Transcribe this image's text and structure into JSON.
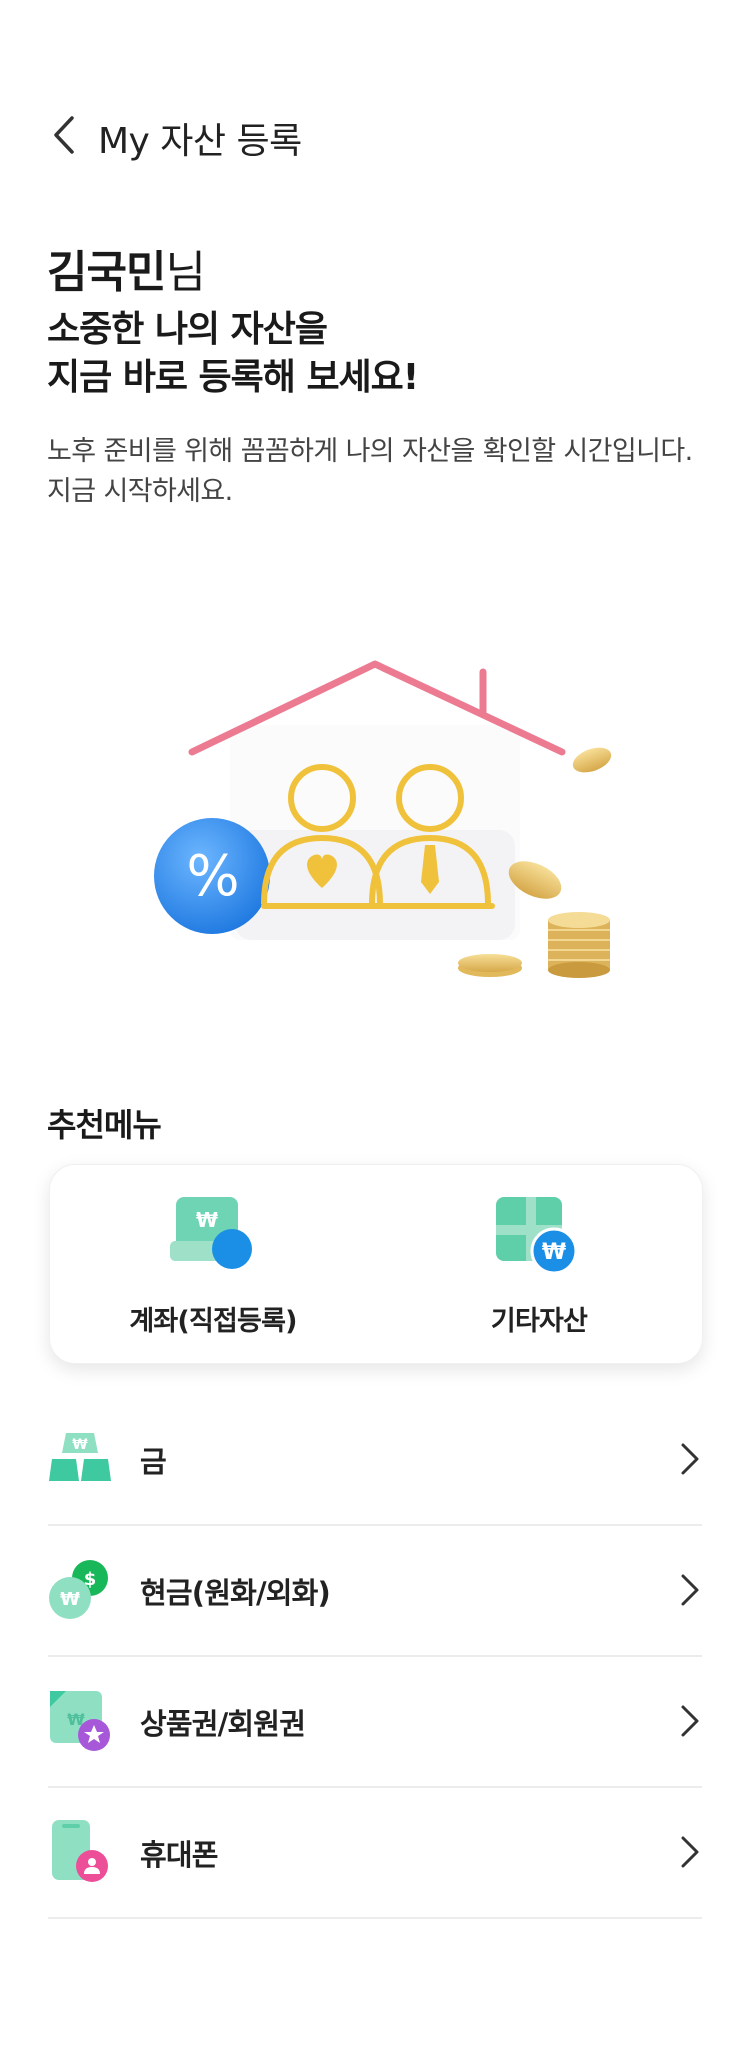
{
  "header": {
    "title": "My 자산 등록"
  },
  "greeting": {
    "name": "김국민",
    "suffix": "님"
  },
  "headline": {
    "line1": "소중한 나의 자산을",
    "line2": "지금 바로 등록해 보세요!"
  },
  "description": {
    "line1": "노후 준비를 위해 꼼꼼하게 나의 자산을 확인할 시간입니다.",
    "line2": "지금 시작하세요."
  },
  "hero": {
    "percent_symbol": "%"
  },
  "recommended": {
    "title": "추천메뉴",
    "items": [
      {
        "label": "계좌(직접등록)",
        "icon": "account-card-icon"
      },
      {
        "label": "기타자산",
        "icon": "other-assets-icon"
      }
    ]
  },
  "list": {
    "items": [
      {
        "label": "금",
        "icon": "gold-bars-icon"
      },
      {
        "label": "현금(원화/외화)",
        "icon": "cash-coins-icon"
      },
      {
        "label": "상품권/회원권",
        "icon": "voucher-icon"
      },
      {
        "label": "휴대폰",
        "icon": "phone-icon"
      }
    ]
  },
  "colors": {
    "accent_green": "#3fc9a0",
    "accent_blue": "#1b8fe6",
    "roof_pink": "#ec7b92",
    "gold": "#f0c23c"
  }
}
